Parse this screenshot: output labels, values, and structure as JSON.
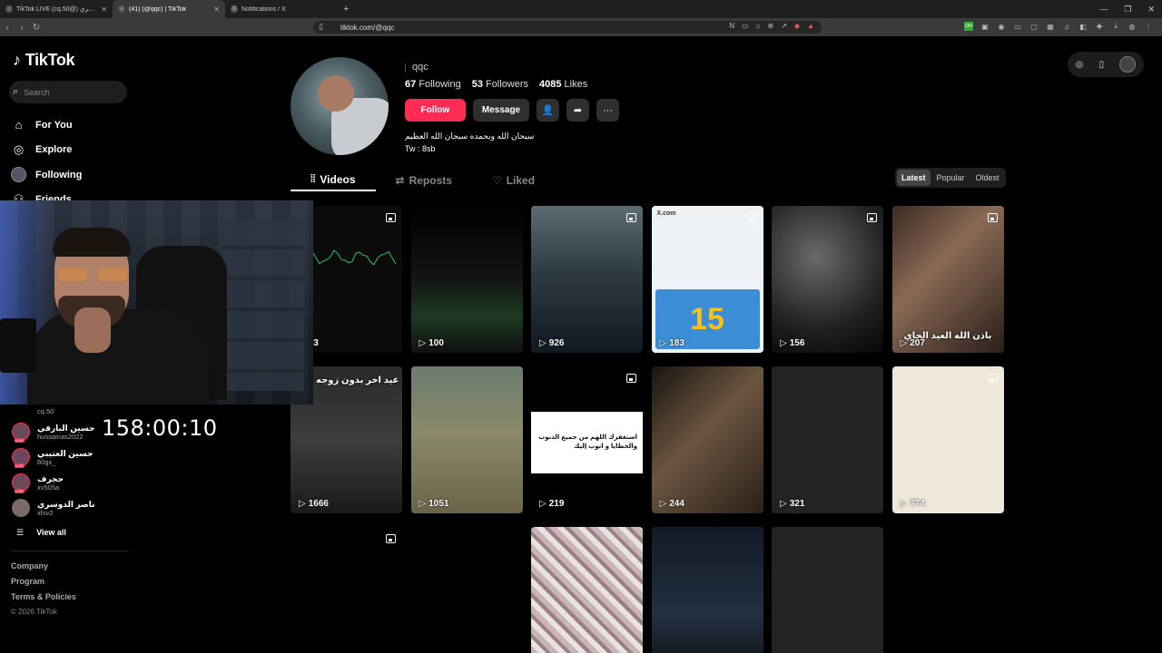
{
  "browser": {
    "tabs": [
      {
        "title": "TikTok LIVE (cq.50@) خالد الشمري",
        "active": false
      },
      {
        "title": "(41) (@qqc) | TikTok",
        "active": true
      },
      {
        "title": "Notifications / X",
        "active": false
      }
    ],
    "url": "tiktok.com/@qqc"
  },
  "sidebar": {
    "logo": "TikTok",
    "search_placeholder": "Search",
    "menu": [
      {
        "label": "For You",
        "icon": "home-icon"
      },
      {
        "label": "Explore",
        "icon": "compass-icon"
      },
      {
        "label": "Following",
        "icon": "avatar-icon"
      },
      {
        "label": "Friends",
        "icon": "friends-icon"
      }
    ],
    "following_accounts": [
      {
        "name": "",
        "username": "cq.50",
        "live": true
      },
      {
        "name": "حسين البارقي",
        "username": "hussainas2022",
        "live": true
      },
      {
        "name": "حسين العتيبي",
        "username": "60gx_",
        "live": true
      },
      {
        "name": "حجرف",
        "username": "xv505a",
        "live": true
      },
      {
        "name": "ناصر الدوسري",
        "username": "xfsv2",
        "live": false
      }
    ],
    "view_all": "View all",
    "footer": [
      "Company",
      "Program",
      "Terms & Policies"
    ],
    "copyright": "© 2026 TikTok"
  },
  "overlay": {
    "timer": "158:00:10"
  },
  "profile": {
    "username": "qqc",
    "following_count": "67",
    "following_label": "Following",
    "followers_count": "53",
    "followers_label": "Followers",
    "likes_count": "4085",
    "likes_label": "Likes",
    "follow_button": "Follow",
    "message_button": "Message",
    "bio_line1": "سبحان الله وبحمده سبحان الله العظيم",
    "bio_line2": "Tw : 8sb"
  },
  "tabs": [
    {
      "label": "Videos",
      "active": true
    },
    {
      "label": "Reposts",
      "active": false
    },
    {
      "label": "Liked",
      "active": false
    }
  ],
  "sort": [
    {
      "label": "Latest",
      "active": true
    },
    {
      "label": "Popular",
      "active": false
    },
    {
      "label": "Oldest",
      "active": false
    }
  ],
  "videos": [
    {
      "views": "33",
      "photo": true,
      "style": "chart",
      "caption": ""
    },
    {
      "views": "100",
      "photo": false,
      "style": "night",
      "caption": ""
    },
    {
      "views": "926",
      "photo": true,
      "style": "sleep",
      "caption": ""
    },
    {
      "views": "183",
      "photo": true,
      "style": "tweet15",
      "caption": "X.com"
    },
    {
      "views": "156",
      "photo": true,
      "style": "ronaldo",
      "caption": ""
    },
    {
      "views": "207",
      "photo": true,
      "style": "couple",
      "caption": "باذن الله العيد الجاي"
    },
    {
      "views": "1666",
      "photo": false,
      "style": "rain",
      "caption": "Pov: عيد اخر بدون زوجه"
    },
    {
      "views": "1051",
      "photo": false,
      "style": "desert",
      "caption": ""
    },
    {
      "views": "219",
      "photo": true,
      "style": "tweetcard",
      "caption": "استغفرك اللهم من جميع الذنوب والخطايا و اتوب إليك"
    },
    {
      "views": "244",
      "photo": false,
      "style": "building",
      "caption": ""
    },
    {
      "views": "321",
      "photo": false,
      "style": "gray",
      "caption": ""
    },
    {
      "views": "774",
      "photo": true,
      "style": "paper",
      "caption": ""
    },
    {
      "views": "",
      "photo": true,
      "style": "empty",
      "caption": ""
    },
    {
      "views": "",
      "photo": false,
      "style": "empty",
      "caption": ""
    },
    {
      "views": "",
      "photo": false,
      "style": "crowd",
      "caption": ""
    },
    {
      "views": "",
      "photo": false,
      "style": "sky",
      "caption": ""
    },
    {
      "views": "",
      "photo": false,
      "style": "gray",
      "caption": ""
    }
  ],
  "colors": {
    "accent": "#fe2c55",
    "background": "#000000"
  }
}
